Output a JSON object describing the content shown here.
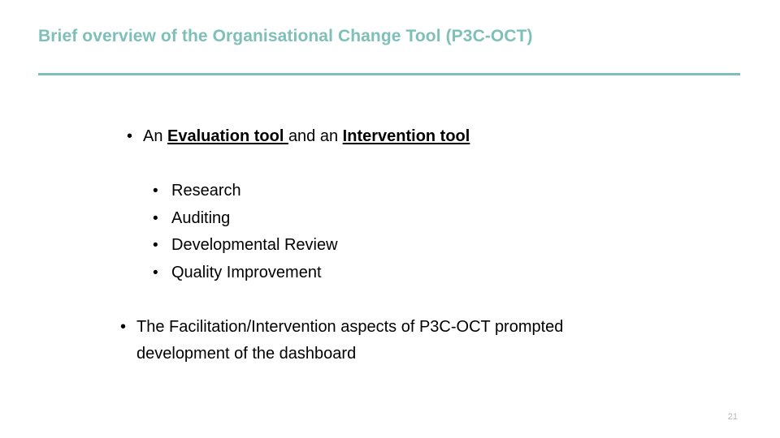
{
  "slide": {
    "title": "Brief overview of the Organisational Change Tool (P3C-OCT)",
    "title_color": "#7EC0B9",
    "rule_color": "#7EC0B9",
    "background_color": "#FFFFFF",
    "body_text_color": "#000000",
    "page_number": "21",
    "bullet_glyph": "•"
  },
  "content": {
    "bullet_evaluation": {
      "lead_text": "An ",
      "emphasis_one": "Evaluation tool",
      "middle_text": " and an ",
      "emphasis_two": "Intervention tool"
    },
    "sub_bullets": [
      {
        "label": "Research"
      },
      {
        "label": "Auditing"
      },
      {
        "label": "Developmental Review"
      },
      {
        "label": "Quality Improvement"
      }
    ],
    "bullet_dashboard": {
      "text": "The Facilitation/Intervention aspects of P3C-OCT prompted development of the dashboard"
    }
  }
}
